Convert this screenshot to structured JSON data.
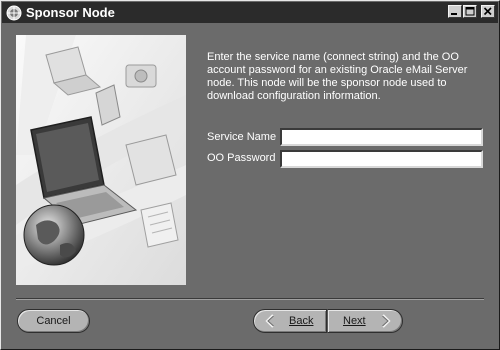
{
  "window": {
    "title": "Sponsor Node",
    "title_icon": "oracle-installer-icon",
    "controls": [
      "minimize-icon",
      "maximize-icon",
      "close-icon"
    ]
  },
  "panel": {
    "image": "computer-globe-illustration"
  },
  "content": {
    "instructions": "Enter the service name (connect string) and the OO account password for an existing Oracle eMail Server node. This node will be the sponsor node used to download configuration information.",
    "service_name_label": "Service Name",
    "service_name_value": "",
    "oo_password_label": "OO Password",
    "oo_password_value": ""
  },
  "buttons": {
    "cancel_label": "Cancel",
    "back_label": "Back",
    "next_label": "Next",
    "back_icon": "chevron-left-icon",
    "next_icon": "chevron-right-icon"
  },
  "colors": {
    "background": "#6b6b6b",
    "titlebar": "#2b2b2b",
    "button": "#b4b4b4"
  }
}
